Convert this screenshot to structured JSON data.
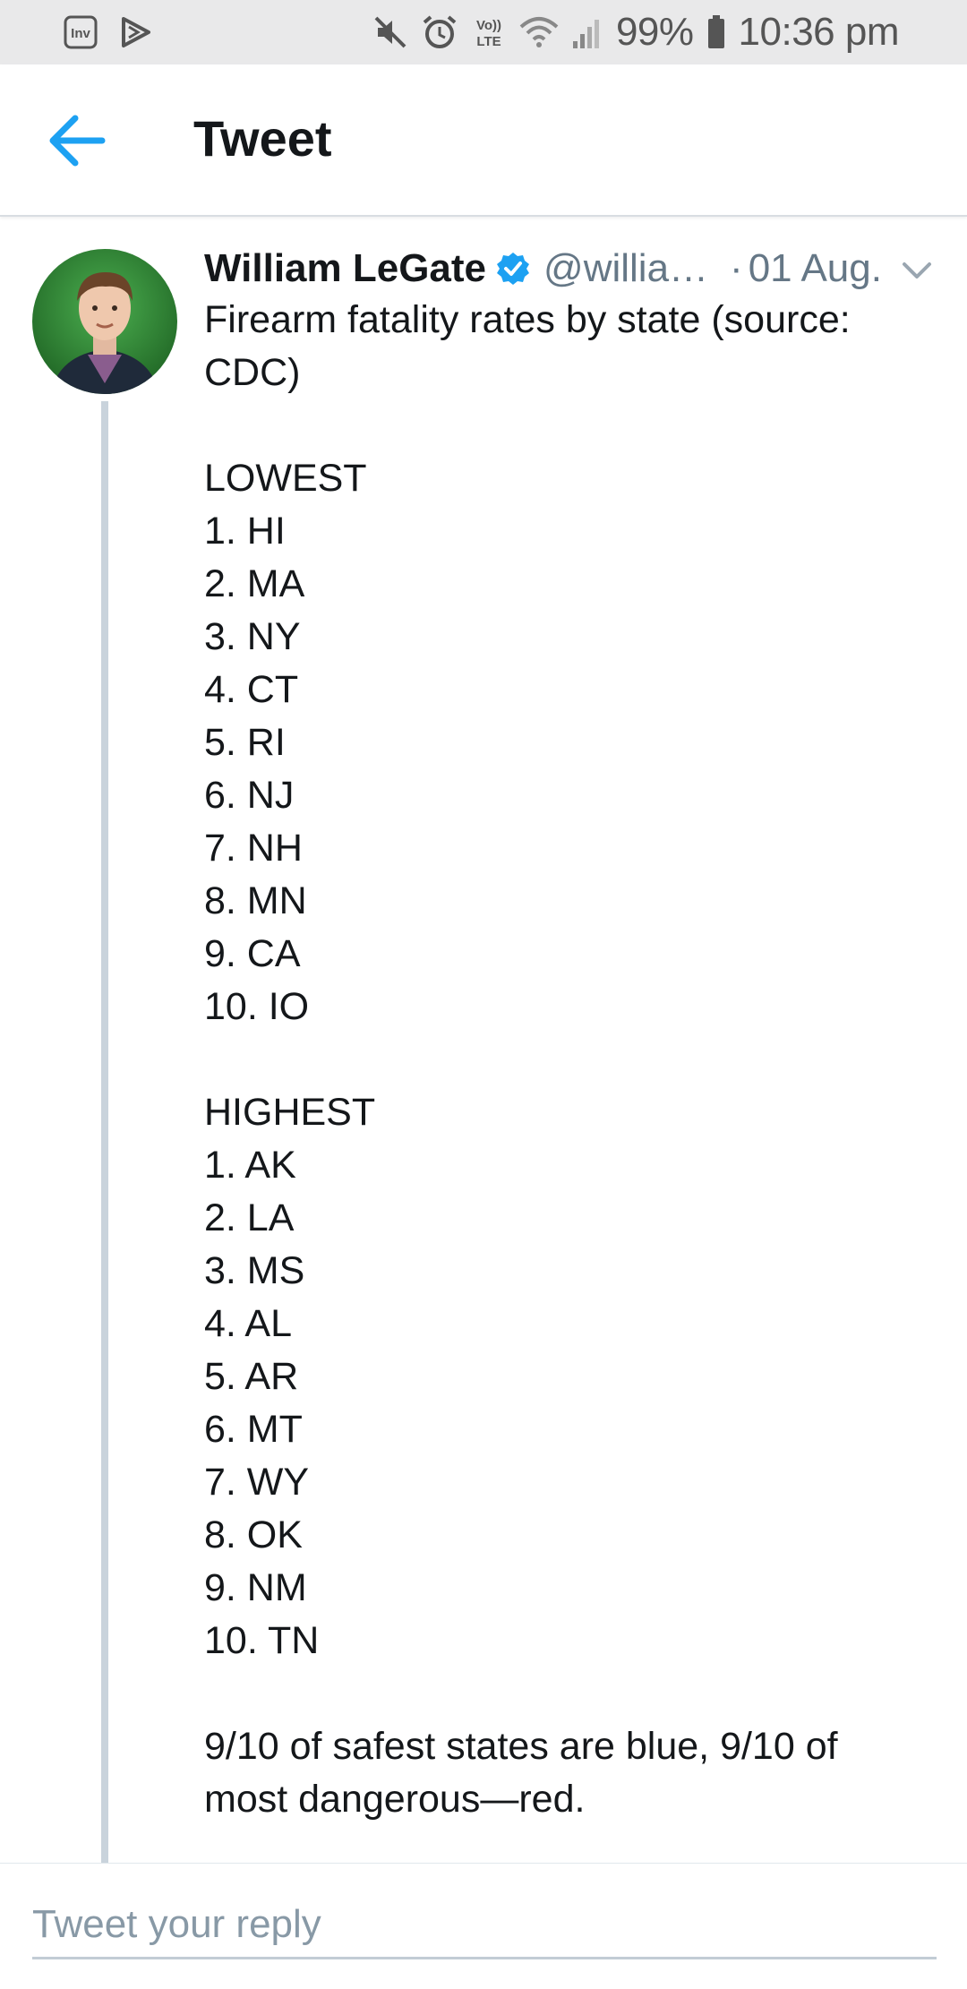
{
  "status_bar": {
    "left_icons": [
      "inv-app-icon",
      "play-store-icon"
    ],
    "right_icons": [
      "mute-icon",
      "alarm-icon",
      "volte-icon",
      "wifi-icon",
      "signal-icon"
    ],
    "volte_label": "Vo)) LTE",
    "battery_percent": "99%",
    "time": "10:36 pm"
  },
  "app_bar": {
    "title": "Tweet",
    "back_icon": "arrow-left-icon"
  },
  "tweet": {
    "author_name": "William LeGate",
    "verified": true,
    "handle": "@willia…",
    "separator": "·",
    "timestamp": "01 Aug.",
    "text_lines": [
      "Firearm fatality rates by state (source:",
      "CDC)",
      "",
      "LOWEST",
      "1. HI",
      "2. MA",
      "3. NY",
      "4. CT",
      "5. RI",
      "6. NJ",
      "7. NH",
      "8. MN",
      "9. CA",
      "10. IO",
      "",
      "HIGHEST",
      "1. AK",
      "2. LA",
      "3. MS",
      "4. AL",
      "5. AR",
      "6. MT",
      "7. WY",
      "8. OK",
      "9. NM",
      "10. TN",
      "",
      "9/10 of safest states are blue, 9/10 of",
      "most dangerous—red."
    ]
  },
  "reply": {
    "placeholder": "Tweet your reply",
    "value": ""
  },
  "colors": {
    "accent": "#1da1f2",
    "status_bar_bg": "#e9e9ea",
    "text_primary": "#14171a",
    "text_secondary": "#657786",
    "thread_line": "#c9d3dc"
  }
}
